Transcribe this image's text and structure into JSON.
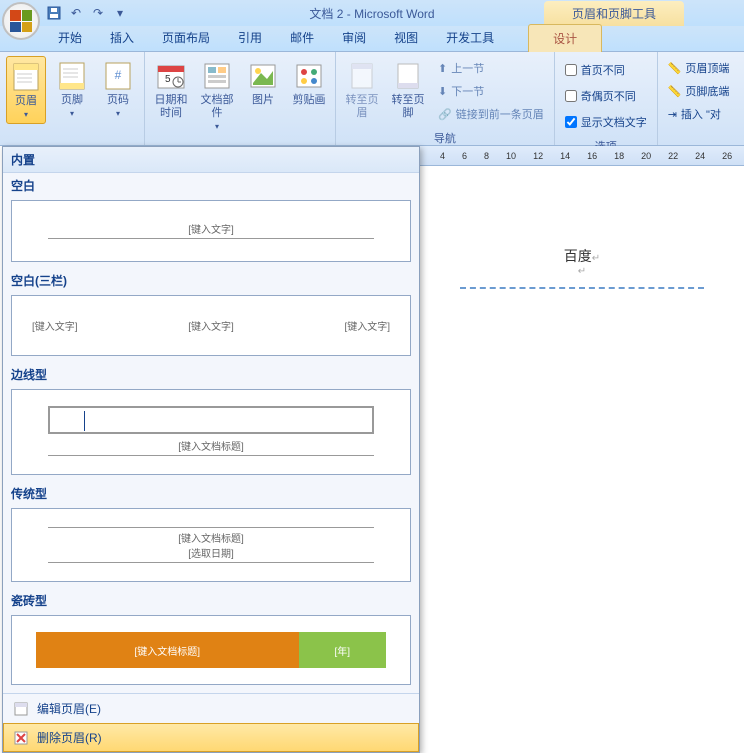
{
  "qat": {
    "save": "💾",
    "undo": "↶",
    "redo": "↷"
  },
  "title": "文档 2 - Microsoft Word",
  "context_title": "页眉和页脚工具",
  "tabs": [
    "开始",
    "插入",
    "页面布局",
    "引用",
    "邮件",
    "审阅",
    "视图",
    "开发工具"
  ],
  "context_tab": "设计",
  "ribbon": {
    "g1": {
      "header": {
        "label": "页眉"
      },
      "footer": {
        "label": "页脚"
      },
      "pagenum": {
        "label": "页码"
      }
    },
    "g2": {
      "datetime": {
        "label": "日期和\n时间"
      },
      "quickparts": {
        "label": "文档部件"
      },
      "picture": {
        "label": "图片"
      },
      "clipart": {
        "label": "剪贴画"
      }
    },
    "g3": {
      "gotoHeader": {
        "label": "转至页眉"
      },
      "gotoFooter": {
        "label": "转至页脚"
      },
      "prev": "上一节",
      "next": "下一节",
      "link": "链接到前一条页眉",
      "group_label": "导航"
    },
    "g4": {
      "diffFirst": "首页不同",
      "diffOddEven": "奇偶页不同",
      "showDoc": "显示文档文字",
      "group_label": "选项"
    },
    "g5": {
      "headerTop": "页眉顶端",
      "footerBottom": "页脚底端",
      "insertAlign": "插入 \"对"
    }
  },
  "gallery": {
    "section": "内置",
    "items": [
      {
        "title": "空白",
        "placeholder": "[键入文字]"
      },
      {
        "title": "空白(三栏)",
        "placeholder": "[键入文字]"
      },
      {
        "title": "边线型",
        "placeholder": "[键入文档标题]"
      },
      {
        "title": "传统型",
        "line1": "[键入文档标题]",
        "line2": "[选取日期]"
      },
      {
        "title": "瓷砖型",
        "left": "[键入文档标题]",
        "right": "[年]"
      }
    ],
    "edit": "编辑页眉(E)",
    "remove": "删除页眉(R)"
  },
  "ruler_marks": [
    "4",
    "6",
    "8",
    "10",
    "12",
    "14",
    "16",
    "18",
    "20",
    "22",
    "24",
    "26"
  ],
  "doc": {
    "header_text": "百度"
  }
}
